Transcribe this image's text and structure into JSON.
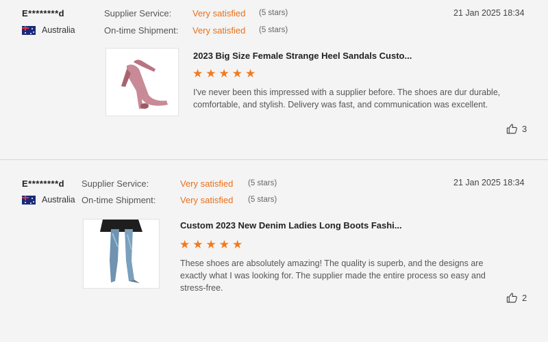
{
  "reviews": [
    {
      "user": "E********d",
      "country": "Australia",
      "supplier_label": "Supplier Service:",
      "supplier_value": "Very satisfied",
      "supplier_stars": "(5 stars)",
      "shipment_label": "On-time Shipment:",
      "shipment_value": "Very satisfied",
      "shipment_stars": "(5 stars)",
      "date": "21 Jan 2025 18:34",
      "product_title": "2023 Big Size Female Strange Heel Sandals Custo...",
      "rating": 5,
      "text": "I've never been this impressed with a supplier before.  The shoes are dur durable, comfortable, and stylish. Delivery was fast, and communication was excellent.",
      "likes": "3",
      "icons": {
        "flag": "australia-flag-icon",
        "like": "thumbs-up-icon",
        "product": "pink-heel-sandal-image"
      }
    },
    {
      "user": "E********d",
      "country": "Australia",
      "supplier_label": "Supplier Service:",
      "supplier_value": "Very satisfied",
      "supplier_stars": "(5 stars)",
      "shipment_label": "On-time Shipment:",
      "shipment_value": "Very satisfied",
      "shipment_stars": "(5 stars)",
      "date": "21 Jan 2025 18:34",
      "product_title": "Custom 2023 New Denim Ladies Long Boots Fashi...",
      "rating": 5,
      "text": "These shoes are absolutely amazing! The quality is superb, and the designs are exactly what I was looking for. The supplier made the entire process so easy and stress-free.",
      "likes": "2",
      "icons": {
        "flag": "australia-flag-icon",
        "like": "thumbs-up-icon",
        "product": "denim-boots-image"
      }
    }
  ],
  "colors": {
    "accent": "#e8701a",
    "star": "#f17a1f",
    "background": "#f4f4f4"
  }
}
